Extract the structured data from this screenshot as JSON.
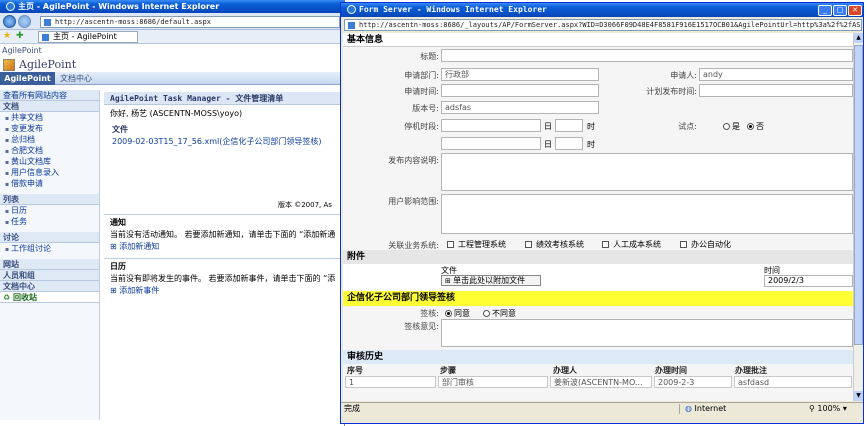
{
  "back_window": {
    "title": "主页 - AgilePoint - Windows Internet Explorer",
    "address": "http://ascentn-moss:8686/default.aspx",
    "tab_label": "主页 - AgilePoint",
    "site_crumb": "AgilePoint",
    "site_title": "AgilePoint",
    "top_tabs": [
      "AgilePoint",
      "文档中心"
    ],
    "view_all": "查看所有网站内容",
    "nav": {
      "docs_head": "文档",
      "docs": [
        "共享文档",
        "变更发布",
        "总归档",
        "合肥文档",
        "黄山文档库",
        "用户信息录入",
        "借款申请"
      ],
      "lists_head": "列表",
      "lists": [
        "日历",
        "任务"
      ],
      "discuss_head": "讨论",
      "discuss": [
        "工作组讨论"
      ],
      "sites_head": "网站",
      "people_head": "人员和组",
      "doccenter_head": "文档中心",
      "recycle": "回收站"
    },
    "main": {
      "title": "AgilePoint Task Manager - 文件管理清单",
      "greeting": "你好, 杨艺 (ASCENTN-MOSS\\yoyo)",
      "file_head": "文件",
      "file_link": "2009-02-03T15_17_56.xml(企信化子公司部门领导签核)",
      "version": "版本 ©2007, As",
      "notice_head": "通知",
      "notice_text": "当前没有活动通知。 若要添加新通知，请单击下面的 “添加新通",
      "notice_add": "添加新通知",
      "calendar_head": "日历",
      "calendar_text": "当前没有即将发生的事件。 若要添加新事件，请单击下面的 “添",
      "calendar_add": "添加新事件"
    }
  },
  "form_window": {
    "title": "Form Server - Windows Internet Explorer",
    "address": "http://ascentn-moss:8686/_layouts/AP/FormServer.aspx?WID=D3066F09D48E4F8581F916E1517OCB01&AgilePointUrl=http%3a%2f%2fASCENT",
    "basic_info": "基本信息",
    "fields": {
      "title_label": "标题:",
      "dept_label": "申请部门:",
      "dept_value": "行政部",
      "applicant_label": "申请人:",
      "applicant_value": "andy",
      "apply_time_label": "申请时间:",
      "plan_time_label": "计划发布时间:",
      "version_label": "版本号:",
      "version_value": "adsfas",
      "downtime_label": "停机时段:",
      "day_label": "日",
      "hour_label": "时",
      "trial_label": "试点:",
      "yes_label": "是",
      "no_label": "否",
      "content_label": "发布内容说明:",
      "impact_label": "用户影响范围:",
      "related_label": "关联业务系统:",
      "systems": [
        "工程管理系统",
        "绩效考核系统",
        "人工成本系统",
        "办公自动化"
      ]
    },
    "attachment": {
      "head": "附件",
      "file_col": "文件",
      "time_col": "时间",
      "attach_button": "单击此处以附加文件",
      "time_value": "2009/2/3"
    },
    "signoff": {
      "head": "企信化子公司部门领导签核",
      "sign_label": "签核:",
      "agree": "同意",
      "disagree": "不同意",
      "comment_label": "签核意见:"
    },
    "history": {
      "head": "审核历史",
      "columns": [
        "序号",
        "步骤",
        "办理人",
        "办理时间",
        "办理批注"
      ],
      "rows": [
        [
          "1",
          "部门审核",
          "姜新波(ASCENTN-MO...",
          "2009-2-3",
          "asfdasd"
        ]
      ]
    },
    "status": {
      "done": "完成",
      "zone": "Internet",
      "zoom": "100%"
    }
  }
}
